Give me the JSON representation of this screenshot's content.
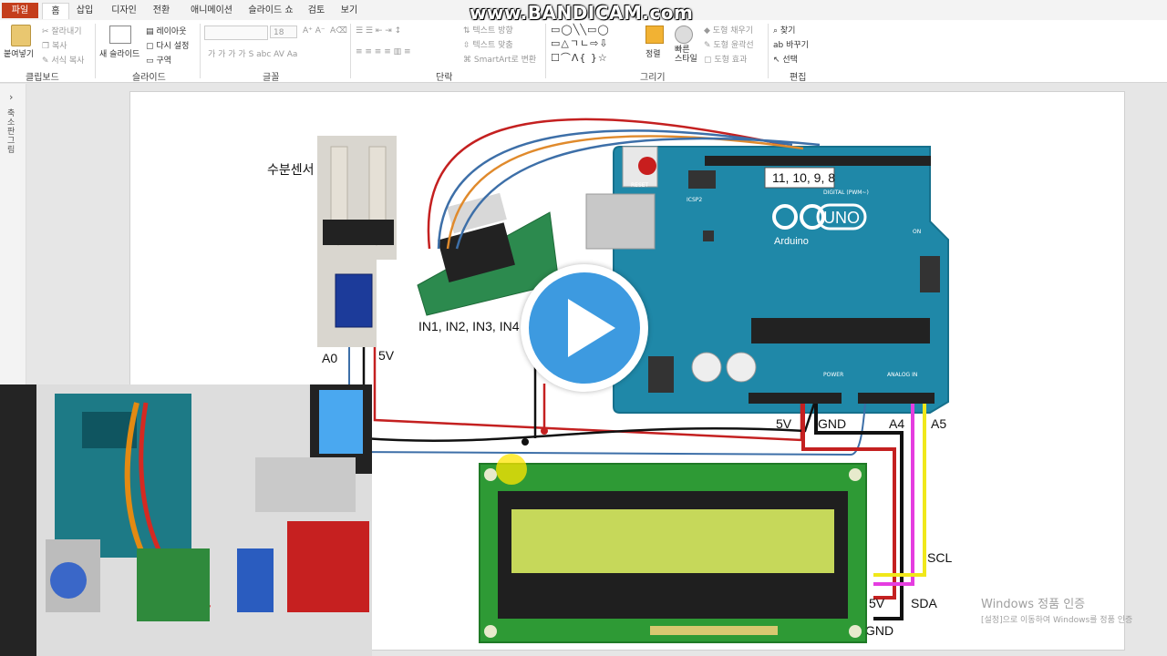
{
  "ribbon": {
    "tabs": [
      "파일",
      "홈",
      "삽입",
      "디자인",
      "전환",
      "애니메이션",
      "슬라이드 쇼",
      "검토",
      "보기"
    ],
    "clipboard": {
      "paste": "붙여넣기",
      "cut": "잘라내기",
      "copy": "복사",
      "format_painter": "서식 복사",
      "label": "클립보드"
    },
    "slides": {
      "new_slide": "새 슬라이드",
      "layout": "레이아웃",
      "reset": "다시 설정",
      "section": "구역",
      "label": "슬라이드"
    },
    "font": {
      "size": "18",
      "label": "글꼴"
    },
    "paragraph": {
      "text_direction": "텍스트 방향",
      "align_text": "텍스트 맞춤",
      "smartart": "SmartArt로 변환",
      "label": "단락"
    },
    "drawing": {
      "arrange": "정렬",
      "quick_styles": "빠른 스타일",
      "fill": "도형 채우기",
      "outline": "도형 윤곽선",
      "effects": "도형 효과",
      "label": "그리기"
    },
    "editing": {
      "find": "찾기",
      "replace": "바꾸기",
      "select": "선택",
      "label": "편집"
    }
  },
  "watermark": "www.BANDICAM.com",
  "left_pane": {
    "label": "축소판 그림"
  },
  "diagram": {
    "labels": {
      "sensor": "수분센서",
      "a0": "A0",
      "sensor_5v": "5V",
      "digital_pins": "11, 10, 9, 8",
      "driver_inputs": "IN1, IN2, IN3, IN4",
      "power_5v": "5V",
      "power_gnd": "GND",
      "a4": "A4",
      "a5": "A5",
      "scl": "SCL",
      "sda": "SDA",
      "lcd_5v": "5V",
      "lcd_gnd": "GND"
    },
    "arduino": {
      "brand": "Arduino",
      "model": "UNO",
      "reset": "RESET",
      "icsp": "ICSP2",
      "digital": "DIGITAL (PWM~)",
      "analog": "ANALOG IN",
      "power": "POWER",
      "on": "ON"
    }
  },
  "activation": {
    "title": "Windows 정품 인증",
    "subtitle": "[설정]으로 이동하여 Windows를 정품 인증"
  },
  "colors": {
    "board": "#1f88a8",
    "lcd": "#2e9a35",
    "lcd_screen": "#c6d85a",
    "file_tab": "#c43e1c",
    "play": "#3d9ae0"
  }
}
